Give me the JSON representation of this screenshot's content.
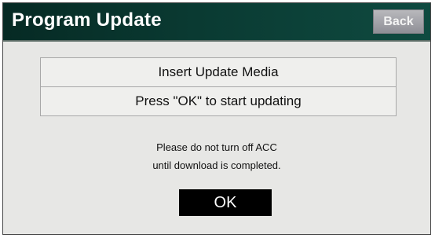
{
  "header": {
    "title": "Program Update",
    "back_label": "Back"
  },
  "messages": [
    "Insert Update Media",
    "Press \"OK\" to start updating"
  ],
  "notice": {
    "line1": "Please do not turn off ACC",
    "line2": "until download is completed."
  },
  "actions": {
    "ok_label": "OK"
  },
  "colors": {
    "title_bar": "#0a3a32",
    "screen_background": "#e7e7e5",
    "back_button": "#9c9ca3",
    "ok_button": "#000000"
  }
}
